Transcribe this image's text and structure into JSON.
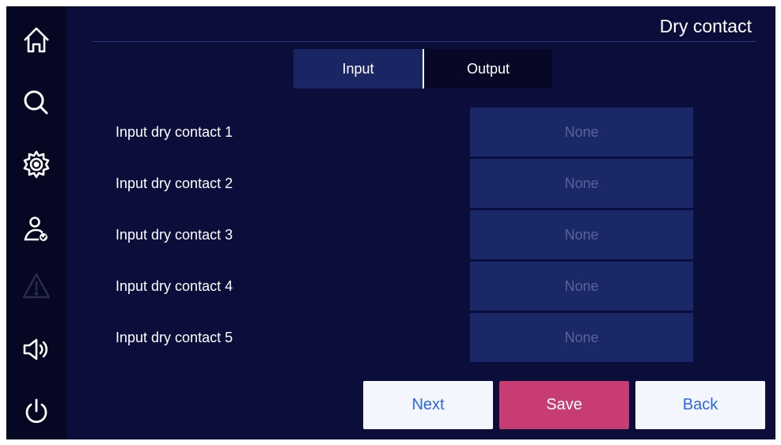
{
  "sidebar": {
    "items": [
      {
        "icon": "home-icon"
      },
      {
        "icon": "search-icon"
      },
      {
        "icon": "gear-icon"
      },
      {
        "icon": "user-check-icon"
      },
      {
        "icon": "warning-icon"
      },
      {
        "icon": "speaker-icon"
      },
      {
        "icon": "power-icon"
      }
    ]
  },
  "header": {
    "title": "Dry contact"
  },
  "tabs": [
    {
      "label": "Input",
      "active": true
    },
    {
      "label": "Output",
      "active": false
    }
  ],
  "rows": [
    {
      "label": "Input dry contact 1",
      "value": "None"
    },
    {
      "label": "Input dry contact 2",
      "value": "None"
    },
    {
      "label": "Input dry contact 3",
      "value": "None"
    },
    {
      "label": "Input dry contact 4",
      "value": "None"
    },
    {
      "label": "Input dry contact 5",
      "value": "None"
    }
  ],
  "buttons": {
    "next": "Next",
    "save": "Save",
    "back": "Back"
  },
  "colors": {
    "background": "#0b0d3a",
    "sidebar": "#060722",
    "field": "#1a2868",
    "save": "#c83c74",
    "button_text": "#2c66e8"
  }
}
